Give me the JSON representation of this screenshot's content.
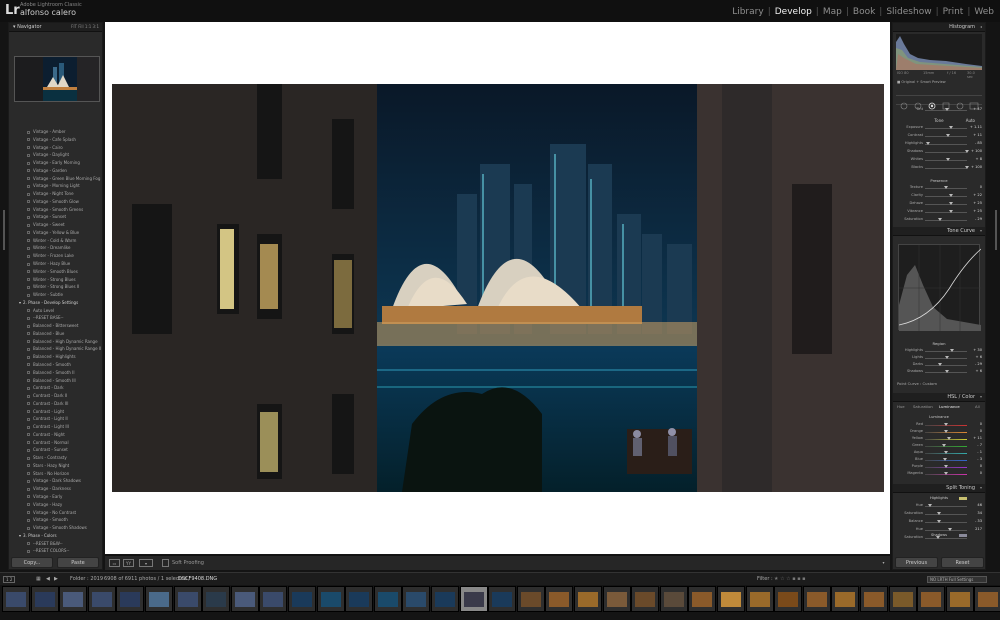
{
  "app": {
    "logo": "Lr",
    "name": "Adobe Lightroom Classic",
    "user": "alfonso calero"
  },
  "modules": [
    "Library",
    "Develop",
    "Map",
    "Book",
    "Slideshow",
    "Print",
    "Web"
  ],
  "modules_active": "Develop",
  "left": {
    "navigator": "Navigator",
    "nav_zoom": "FIT   Fill   1:1   3:1",
    "presets": [
      {
        "t": "Vintage - Amber"
      },
      {
        "t": "Vintage - Cafe Splash"
      },
      {
        "t": "Vintage - Cairo"
      },
      {
        "t": "Vintage - Daylight"
      },
      {
        "t": "Vintage - Early Morning"
      },
      {
        "t": "Vintage - Garden"
      },
      {
        "t": "Vintage - Green Blue Morning Fog"
      },
      {
        "t": "Vintage - Morning Light"
      },
      {
        "t": "Vintage - Night Tone"
      },
      {
        "t": "Vintage - Smooth Glow"
      },
      {
        "t": "Vintage - Smooth Greens"
      },
      {
        "t": "Vintage - Sunset"
      },
      {
        "t": "Vintage - Sweet"
      },
      {
        "t": "Vintage - Yellow & Blue"
      },
      {
        "t": "Winter - Cold & Warm"
      },
      {
        "t": "Winter - Dreamlike"
      },
      {
        "t": "Winter - Frozen Lake"
      },
      {
        "t": "Winter - Hazy Blue"
      },
      {
        "t": "Winter - Smooth Blues"
      },
      {
        "t": "Winter - Strong Blues"
      },
      {
        "t": "Winter - Strong Blues II"
      },
      {
        "t": "Winter - Subtle"
      },
      {
        "t": "2. Phase - Develop Settings",
        "folder": true
      },
      {
        "t": "Auto Level"
      },
      {
        "t": "--RESET BASE--"
      },
      {
        "t": "Balanced - Bittersweet"
      },
      {
        "t": "Balanced - Blue"
      },
      {
        "t": "Balanced - High Dynamic Range"
      },
      {
        "t": "Balanced - High Dynamic Range II"
      },
      {
        "t": "Balanced - Highlights"
      },
      {
        "t": "Balanced - Smooth"
      },
      {
        "t": "Balanced - Smooth II"
      },
      {
        "t": "Balanced - Smooth III"
      },
      {
        "t": "Contrast - Dark"
      },
      {
        "t": "Contrast - Dark II"
      },
      {
        "t": "Contrast - Dark III"
      },
      {
        "t": "Contrast - Light"
      },
      {
        "t": "Contrast - Light II"
      },
      {
        "t": "Contrast - Light III"
      },
      {
        "t": "Contrast - Night"
      },
      {
        "t": "Contrast - Normal"
      },
      {
        "t": "Contrast - Sunset"
      },
      {
        "t": "Stars - Contrasty"
      },
      {
        "t": "Stars - Hazy Night"
      },
      {
        "t": "Stars - No Horizon"
      },
      {
        "t": "Vintage - Dark Shadows"
      },
      {
        "t": "Vintage - Darkness"
      },
      {
        "t": "Vintage - Early"
      },
      {
        "t": "Vintage - Hazy"
      },
      {
        "t": "Vintage - No Contrast"
      },
      {
        "t": "Vintage - Smooth"
      },
      {
        "t": "Vintage - Smooth Shadows"
      },
      {
        "t": "3. Phase - Colors",
        "folder": true
      },
      {
        "t": "--RESET B&W--"
      },
      {
        "t": "--RESET COLORS--"
      }
    ],
    "copy": "Copy...",
    "paste": "Paste"
  },
  "toolbar": {
    "soft_proofing": "Soft Proofing"
  },
  "right": {
    "histogram": "Histogram",
    "hist_info": "Original + Smart Preview",
    "hist_iso": "ISO 80",
    "hist_mm": "15mm",
    "hist_f": "f / 16",
    "hist_s": "30.0 sec",
    "tone": "Tone",
    "auto": "Auto",
    "presence": "Presence",
    "tone_rows": [
      {
        "l": "Exposure",
        "v": "+ 1.11",
        "p": 0.62
      },
      {
        "l": "Contrast",
        "v": "+ 11",
        "p": 0.55
      },
      {
        "l": "Highlights",
        "v": "- 85",
        "p": 0.08
      },
      {
        "l": "Shadows",
        "v": "+ 100",
        "p": 1.0
      },
      {
        "l": "Whites",
        "v": "+ 8",
        "p": 0.54
      },
      {
        "l": "Blacks",
        "v": "+ 100",
        "p": 1.0
      }
    ],
    "presence_rows": [
      {
        "l": "Texture",
        "v": "0",
        "p": 0.5
      },
      {
        "l": "Clarity",
        "v": "+ 22",
        "p": 0.61
      },
      {
        "l": "Dehaze",
        "v": "+ 25",
        "p": 0.62
      },
      {
        "l": "Vibrance",
        "v": "+ 25",
        "p": 0.62
      },
      {
        "l": "Saturation",
        "v": "- 29",
        "p": 0.35
      }
    ],
    "tone_curve": "Tone Curve",
    "region": "Region",
    "region_rows": [
      {
        "l": "Highlights",
        "v": "+ 30",
        "p": 0.65
      },
      {
        "l": "Lights",
        "v": "+ 6",
        "p": 0.53
      },
      {
        "l": "Darks",
        "v": "- 29",
        "p": 0.35
      },
      {
        "l": "Shadows",
        "v": "+ 6",
        "p": 0.53
      }
    ],
    "point_curve": "Point Curve : Custom",
    "hsl": "HSL / Color",
    "hsl_tabs": [
      "Hue",
      "Saturation",
      "Luminance",
      "All"
    ],
    "luminance": "Luminance",
    "lum_rows": [
      {
        "l": "Red",
        "v": "0",
        "p": 0.5,
        "c": "#c33"
      },
      {
        "l": "Orange",
        "v": "0",
        "p": 0.5,
        "c": "#d83"
      },
      {
        "l": "Yellow",
        "v": "+ 11",
        "p": 0.56,
        "c": "#cc3"
      },
      {
        "l": "Green",
        "v": "- 7",
        "p": 0.46,
        "c": "#3a3"
      },
      {
        "l": "Aqua",
        "v": "- 1",
        "p": 0.5,
        "c": "#3aa"
      },
      {
        "l": "Blue",
        "v": "- 3",
        "p": 0.48,
        "c": "#36c"
      },
      {
        "l": "Purple",
        "v": "0",
        "p": 0.5,
        "c": "#93c"
      },
      {
        "l": "Magenta",
        "v": "0",
        "p": 0.5,
        "c": "#c3a"
      }
    ],
    "split": "Split Toning",
    "highlights": "Highlights",
    "shadows": "Shadows",
    "split_rows": [
      {
        "l": "Hue",
        "v": "46",
        "p": 0.13
      },
      {
        "l": "Saturation",
        "v": "34",
        "p": 0.34
      },
      {
        "l": "Balance",
        "v": "- 33",
        "p": 0.33
      },
      {
        "l": "Hue",
        "v": "217",
        "p": 0.6
      },
      {
        "l": "Saturation",
        "v": "",
        "p": 0.3
      }
    ],
    "previous": "Previous",
    "reset": "Reset"
  },
  "filmbar": {
    "pages": "1  2",
    "folder": "Folder : 2019",
    "count": "6908 of 6911 photos / 1 selected /",
    "file": "DSCF9408.DNG",
    "filter": "Filter :",
    "filter_val": "NO LRTH Full Settings"
  },
  "film_colors": [
    "#3a4a6a",
    "#2a3a5a",
    "#4a5a7a",
    "#3a4a6a",
    "#2a3a5a",
    "#4a6a8a",
    "#3a4a6a",
    "#2a3a4a",
    "#4a5a7a",
    "#3a4a6a",
    "#1a3a5a",
    "#1a4a6a",
    "#1a3a5a",
    "#1a4a6a",
    "#2a4a6a",
    "#1a3a5a",
    "#3a3a4a",
    "#1a3a5a",
    "#6a4a2a",
    "#8a5a2a",
    "#9a6a2a",
    "#7a5a3a",
    "#6a4a2a",
    "#5a4a3a",
    "#8a5a2a",
    "#c08a3a",
    "#9a6a2a",
    "#7a4a1a",
    "#8a5a2a",
    "#9a6a2a",
    "#8a5a2a",
    "#7a5a2a",
    "#8a5a2a",
    "#9a6a2a",
    "#8a5a2a"
  ]
}
